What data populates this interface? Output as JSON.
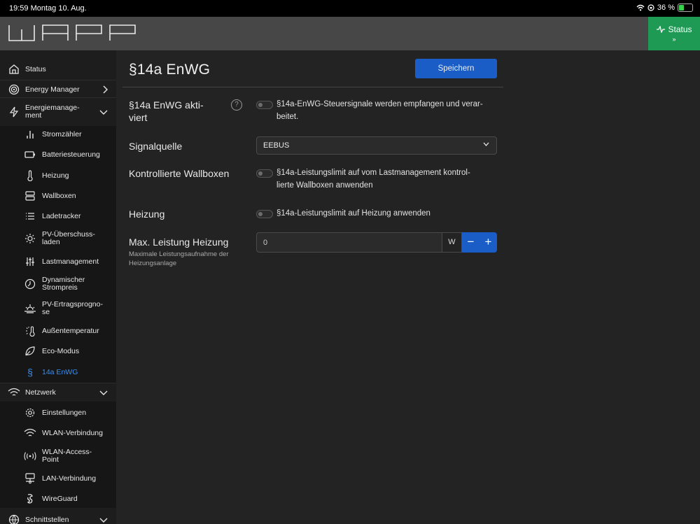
{
  "ios_status": {
    "time_date": "19:59  Montag 10. Aug.",
    "battery": "36 %"
  },
  "header": {
    "status_label": "Status"
  },
  "sidebar": {
    "items": [
      {
        "label": "Status"
      },
      {
        "label": "Energy Manager"
      },
      {
        "label": "Energiemanage-\nment"
      },
      {
        "label": "Stromzähler"
      },
      {
        "label": "Batteriesteuerung"
      },
      {
        "label": "Heizung"
      },
      {
        "label": "Wallboxen"
      },
      {
        "label": "Ladetracker"
      },
      {
        "label": "PV-Überschuss-\nladen"
      },
      {
        "label": "Lastmanagement"
      },
      {
        "label": "Dynamischer\nStrompreis"
      },
      {
        "label": "PV-Ertragsprogno-\nse"
      },
      {
        "label": "Außentemperatur"
      },
      {
        "label": "Eco-Modus"
      },
      {
        "label": "14a EnWG"
      },
      {
        "label": "Netzwerk"
      },
      {
        "label": "Einstellungen"
      },
      {
        "label": "WLAN-Verbindung"
      },
      {
        "label": "WLAN-Access-\nPoint"
      },
      {
        "label": "LAN-Verbindung"
      },
      {
        "label": "WireGuard"
      },
      {
        "label": "Schnittstellen"
      }
    ]
  },
  "main": {
    "title": "§14a EnWG",
    "save_label": "Speichern",
    "enwg_active_label": "§14a EnWG akti-\nviert",
    "enwg_active_desc": "§14a-EnWG-Steuersignale werden empfangen und verar-\nbeitet.",
    "signal_source_label": "Signalquelle",
    "signal_source_value": "EEBUS",
    "wallbox_label": "Kontrollierte Wallboxen",
    "wallbox_desc": "§14a-Leistungslimit auf vom Lastmanagement kontrol-\nlierte Wallboxen anwenden",
    "heating_label": "Heizung",
    "heating_desc": "§14a-Leistungslimit auf Heizung anwenden",
    "max_heating_label": "Max. Leistung Heizung",
    "max_heating_sub": "Maximale Leistungsaufnahme der Heizungsanlage",
    "max_heating_value": "0",
    "max_heating_unit": "W"
  }
}
